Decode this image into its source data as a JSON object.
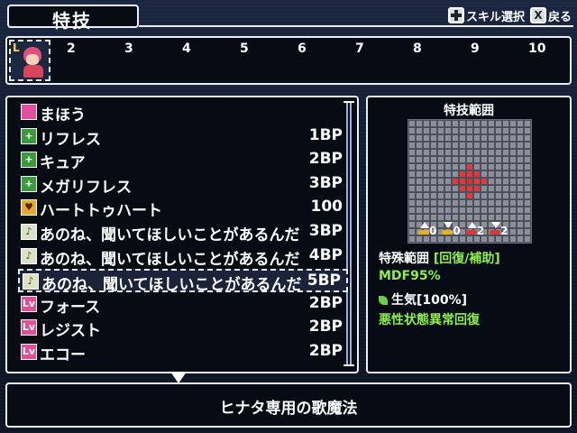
{
  "header": {
    "title": "特技",
    "hints": [
      {
        "icon": "dpad-icon",
        "label": "スキル選択"
      },
      {
        "icon": "x-button-icon",
        "key": "X",
        "label": "戻る"
      }
    ]
  },
  "slots": {
    "portrait_tag": "L",
    "numbers": [
      "2",
      "3",
      "4",
      "5",
      "6",
      "7",
      "8",
      "9",
      "10"
    ]
  },
  "skills": [
    {
      "icon": "magic-category-icon",
      "glyph": "",
      "name": "まほう",
      "cost": ""
    },
    {
      "icon": "heal-icon",
      "glyph": "+",
      "name": "リフレス",
      "cost": "1BP"
    },
    {
      "icon": "heal-icon",
      "glyph": "+",
      "name": "キュア",
      "cost": "2BP"
    },
    {
      "icon": "heal-icon",
      "glyph": "+",
      "name": "メガリフレス",
      "cost": "3BP"
    },
    {
      "icon": "heart-icon",
      "glyph": "♥",
      "name": "ハートトゥハート",
      "cost": "100"
    },
    {
      "icon": "song-icon",
      "glyph": "♪",
      "name": "あのね、聞いてほしいことがあるんだ",
      "cost": "3BP"
    },
    {
      "icon": "song-icon",
      "glyph": "♪",
      "name": "あのね、聞いてほしいことがあるんだ",
      "cost": "4BP"
    },
    {
      "icon": "song-icon",
      "glyph": "♪",
      "name": "あのね、聞いてほしいことがあるんだ",
      "cost": "5BP"
    },
    {
      "icon": "buff-icon",
      "glyph": "Lv",
      "name": "フォース",
      "cost": "2BP"
    },
    {
      "icon": "buff-icon",
      "glyph": "Lv",
      "name": "レジスト",
      "cost": "2BP"
    },
    {
      "icon": "buff-icon",
      "glyph": "Lv",
      "name": "エコー",
      "cost": "2BP"
    }
  ],
  "selected_index": 7,
  "info": {
    "range_title": "特技範囲",
    "range_stats": [
      "0",
      "0",
      "2",
      "2"
    ],
    "range_label": "特殊範囲",
    "range_value": "[回復/補助]",
    "mdf": "MDF95%",
    "vitality": "生気[100%]",
    "status": "悪性状態異常回復"
  },
  "description": "ヒナタ専用の歌魔法",
  "colors": {
    "window_bg": "#070b14",
    "border": "#e9eef8",
    "effect_green": "#8df04a",
    "range_red": "#e03a3a"
  }
}
